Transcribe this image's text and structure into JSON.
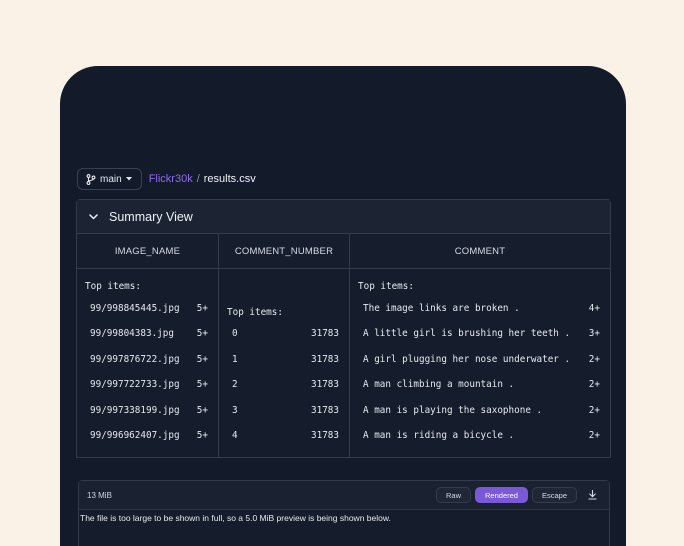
{
  "branch": {
    "label": "main",
    "icon": "git-branch-icon"
  },
  "breadcrumb": {
    "repo": "Flickr30k",
    "separator": "/",
    "file": "results.csv"
  },
  "summary": {
    "title": "Summary View",
    "columns": [
      {
        "header": "IMAGE_NAME",
        "top_label": "Top items:",
        "rows": [
          {
            "value": "99/998845445.jpg",
            "count": "5+"
          },
          {
            "value": "99/99804383.jpg",
            "count": "5+"
          },
          {
            "value": "99/997876722.jpg",
            "count": "5+"
          },
          {
            "value": "99/997722733.jpg",
            "count": "5+"
          },
          {
            "value": "99/997338199.jpg",
            "count": "5+"
          },
          {
            "value": "99/996962407.jpg",
            "count": "5+"
          }
        ]
      },
      {
        "header": "COMMENT_NUMBER",
        "top_label": "Top items:",
        "rows": [
          {
            "value": "0",
            "count": "31783"
          },
          {
            "value": "1",
            "count": "31783"
          },
          {
            "value": "2",
            "count": "31783"
          },
          {
            "value": "3",
            "count": "31783"
          },
          {
            "value": "4",
            "count": "31783"
          }
        ]
      },
      {
        "header": "COMMENT",
        "top_label": "Top items:",
        "rows": [
          {
            "value": "The image links are broken .",
            "count": "4+"
          },
          {
            "value": "A little girl is brushing her teeth .",
            "count": "3+"
          },
          {
            "value": "A girl plugging her nose underwater .",
            "count": "2+"
          },
          {
            "value": "A man climbing a mountain .",
            "count": "2+"
          },
          {
            "value": "A man is playing the saxophone .",
            "count": "2+"
          },
          {
            "value": "A man is riding a bicycle .",
            "count": "2+"
          }
        ]
      }
    ]
  },
  "file_view": {
    "size": "13 MiB",
    "buttons": {
      "raw": "Raw",
      "rendered": "Rendered",
      "escape": "Escape"
    },
    "active_mode": "Rendered",
    "notice": "The file is too large to be shown in full, so a 5.0 MiB preview is being shown below."
  },
  "colors": {
    "accent": "#7a58d8",
    "link": "#8b6cf0",
    "background": "#131a2a",
    "page": "#fbf2e7"
  }
}
